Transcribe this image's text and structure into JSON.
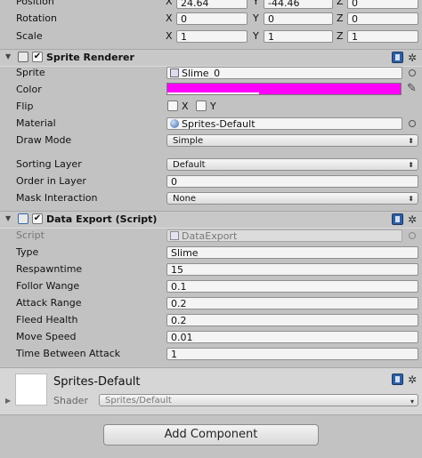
{
  "transform": {
    "rows": [
      {
        "label": "Position",
        "x": "24.64",
        "y": "-44.46",
        "z": "0"
      },
      {
        "label": "Rotation",
        "x": "0",
        "y": "0",
        "z": "0"
      },
      {
        "label": "Scale",
        "x": "1",
        "y": "1",
        "z": "1"
      }
    ],
    "axes": {
      "x": "X",
      "y": "Y",
      "z": "Z"
    }
  },
  "sprite_renderer": {
    "title": "Sprite Renderer",
    "sprite_label": "Sprite",
    "sprite_value": "Slime_0",
    "color_label": "Color",
    "color_hex": "#ff00ff",
    "flip_label": "Flip",
    "flip_x": "X",
    "flip_y": "Y",
    "material_label": "Material",
    "material_value": "Sprites-Default",
    "draw_mode_label": "Draw Mode",
    "draw_mode_value": "Simple",
    "sorting_layer_label": "Sorting Layer",
    "sorting_layer_value": "Default",
    "order_label": "Order in Layer",
    "order_value": "0",
    "mask_label": "Mask Interaction",
    "mask_value": "None"
  },
  "data_export": {
    "title": "Data Export (Script)",
    "script_label": "Script",
    "script_value": "DataExport",
    "fields": [
      {
        "label": "Type",
        "value": "Slime"
      },
      {
        "label": "Respawntime",
        "value": "15"
      },
      {
        "label": "Follor Wange",
        "value": "0.1"
      },
      {
        "label": "Attack Range",
        "value": "0.2"
      },
      {
        "label": "Fleed Health",
        "value": "0.2"
      },
      {
        "label": "Move Speed",
        "value": "0.01"
      },
      {
        "label": "Time Between Attack",
        "value": "1"
      }
    ]
  },
  "material": {
    "name": "Sprites-Default",
    "shader_label": "Shader",
    "shader_value": "Sprites/Default"
  },
  "add_component_label": "Add Component",
  "colors": {
    "panel": "#c2c2c2",
    "header": "#c8c8c8",
    "sprite_color": "#ff00ff"
  }
}
